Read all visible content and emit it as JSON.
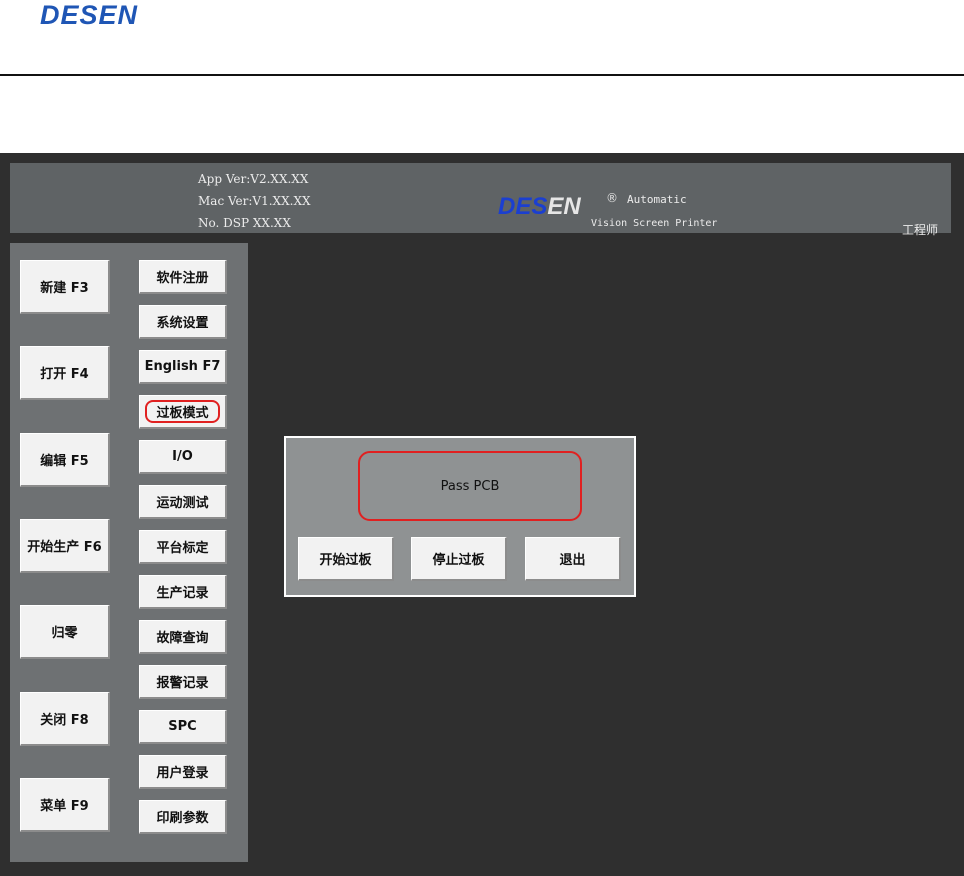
{
  "document": {
    "logo_text": "DESEN"
  },
  "app": {
    "header": {
      "app_version": "App Ver:V2.XX.XX",
      "mac_version": "Mac Ver:V1.XX.XX",
      "dsp_number": "No. DSP XX.XX",
      "logo_text_main": "DES",
      "logo_text_tail": "EN",
      "registered_mark": "®",
      "product_line1": "Automatic",
      "product_line2": "Vision Screen Printer",
      "user_role": "工程师"
    },
    "left_buttons": [
      {
        "label": "新建 F3"
      },
      {
        "label": "打开 F4"
      },
      {
        "label": "编辑 F5"
      },
      {
        "label": "开始生产 F6"
      },
      {
        "label": "归零"
      },
      {
        "label": "关闭 F8"
      },
      {
        "label": "菜单 F9"
      }
    ],
    "menu_buttons": [
      {
        "label": "软件注册"
      },
      {
        "label": "系统设置"
      },
      {
        "label": "English F7"
      },
      {
        "label": "过板模式",
        "highlighted": true
      },
      {
        "label": "I/O"
      },
      {
        "label": "运动测试"
      },
      {
        "label": "平台标定"
      },
      {
        "label": "生产记录"
      },
      {
        "label": "故障查询"
      },
      {
        "label": "报警记录"
      },
      {
        "label": "SPC"
      },
      {
        "label": "用户登录"
      },
      {
        "label": "印刷参数"
      }
    ],
    "dialog": {
      "status_text": "Pass PCB",
      "start_button": "开始过板",
      "stop_button": "停止过板",
      "exit_button": "退出"
    }
  },
  "colors": {
    "brand_blue": "#1f56b5",
    "highlight_red": "#e02020",
    "app_background": "#2f2f2f",
    "panel_gray": "#6e7173"
  }
}
